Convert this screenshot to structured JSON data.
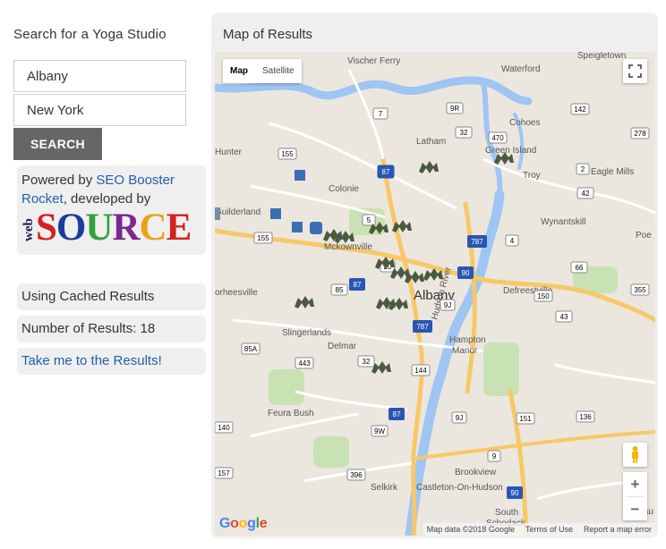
{
  "search": {
    "title": "Search for a Yoga Studio",
    "city_value": "Albany",
    "state_value": "New York",
    "button_label": "SEARCH"
  },
  "powered": {
    "prefix": "Powered by ",
    "link_text": "SEO Booster Rocket",
    "suffix": ", developed by",
    "logo_web": "web",
    "logo_letters": [
      {
        "ch": "S",
        "color": "#d62020"
      },
      {
        "ch": "O",
        "color": "#1a3c9e"
      },
      {
        "ch": "U",
        "color": "#2fa33a"
      },
      {
        "ch": "R",
        "color": "#7a2a8e"
      },
      {
        "ch": "C",
        "color": "#e8a21a"
      },
      {
        "ch": "E",
        "color": "#d62020"
      }
    ]
  },
  "status": {
    "cached": "Using Cached Results",
    "count": "Number of Results: 18",
    "results_link": "Take me to the Results!"
  },
  "map": {
    "title": "Map of Results",
    "type_map": "Map",
    "type_satellite": "Satellite",
    "zoom_in": "+",
    "zoom_out": "−",
    "google": "Google",
    "map_data": "Map data ©2018 Google",
    "terms": "Terms of Use",
    "report": "Report a map error",
    "places": {
      "vischer_ferry": "Vischer Ferry",
      "waterford": "Waterford",
      "speigletown": "Speigletown",
      "cohoes": "Cohoes",
      "latham": "Latham",
      "green_island": "Green Island",
      "hunter": "Hunter",
      "troy": "Troy",
      "eagle_mills": "Eagle Mills",
      "colonie": "Colonie",
      "guilderland": "Guilderland",
      "wynantskill": "Wynantskill",
      "mckownville": "Mckownville",
      "poe": "Poe",
      "albany": "Albany",
      "defreestville": "Defreestville",
      "orheesville": "orheesville",
      "slingerlands": "Slingerlands",
      "delmar": "Delmar",
      "hampton": "Hampton",
      "manor": "Manor",
      "feura_bush": "Feura Bush",
      "brookview": "Brookview",
      "selkirk": "Selkirk",
      "castleton": "Castleton-On-Hudson",
      "south": "South",
      "schodack": "Schodack",
      "nassau": "Nassau",
      "hudson_river": "Hudson River"
    },
    "shields": {
      "s9r": "9R",
      "s32a": "32",
      "s7": "7",
      "s142": "142",
      "s470": "470",
      "s2": "2",
      "s87a": "87",
      "s155a": "155",
      "s155b": "155",
      "s5": "5",
      "s66": "66",
      "s787a": "787",
      "s4": "4",
      "s85": "85",
      "s87b": "87",
      "s90": "90",
      "s787b": "787",
      "s9j": "9J",
      "s20": "20",
      "s150": "150",
      "s32b": "32",
      "s85a": "85A",
      "s443": "443",
      "s144": "144",
      "s87c": "87",
      "s9w": "9W",
      "s43": "43",
      "s396": "396",
      "s9ja": "9J",
      "s90b": "90",
      "s9": "9",
      "s140": "140",
      "s136": "136",
      "s151": "151",
      "s278": "278",
      "s355": "355",
      "s157": "157",
      "s42": "42"
    }
  }
}
